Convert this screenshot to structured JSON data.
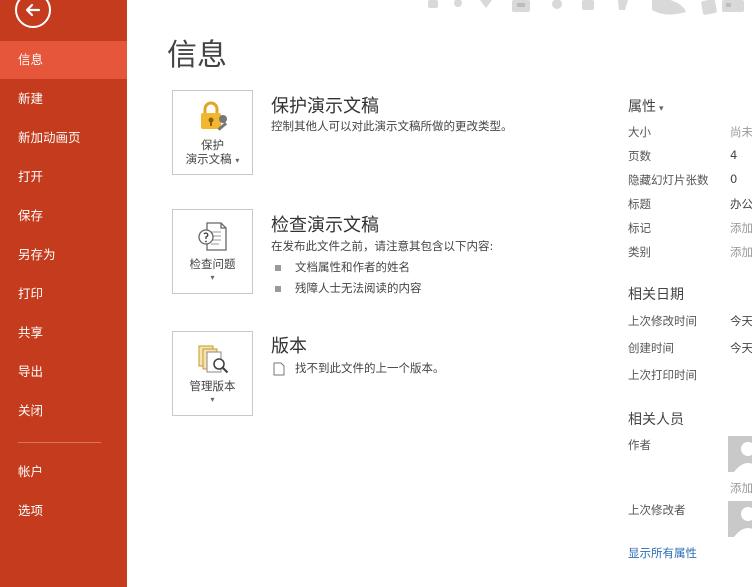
{
  "sidebar": {
    "items": [
      {
        "label": "信息"
      },
      {
        "label": "新建"
      },
      {
        "label": "新加动画页"
      },
      {
        "label": "打开"
      },
      {
        "label": "保存"
      },
      {
        "label": "另存为"
      },
      {
        "label": "打印"
      },
      {
        "label": "共享"
      },
      {
        "label": "导出"
      },
      {
        "label": "关闭"
      },
      {
        "label": "帐户"
      },
      {
        "label": "选项"
      }
    ],
    "active_index": 0,
    "accent_color": "#c43b1d",
    "active_color": "#e5563a"
  },
  "page": {
    "title": "信息"
  },
  "sections": {
    "protect": {
      "tile_line1": "保护",
      "tile_line2": "演示文稿",
      "title": "保护演示文稿",
      "desc": "控制其他人可以对此演示文稿所做的更改类型。"
    },
    "inspect": {
      "tile_label": "检查问题",
      "title": "检查演示文稿",
      "desc": "在发布此文件之前，请注意其包含以下内容:",
      "bullets": [
        "文档属性和作者的姓名",
        "残障人士无法阅读的内容"
      ]
    },
    "versions": {
      "tile_label": "管理版本",
      "title": "版本",
      "desc": "找不到此文件的上一个版本。"
    }
  },
  "properties": {
    "header": "属性",
    "rows": [
      {
        "label": "大小",
        "value": "尚未",
        "muted": true
      },
      {
        "label": "页数",
        "value": "4",
        "muted": false
      },
      {
        "label": "隐藏幻灯片张数",
        "value": "0",
        "muted": false
      },
      {
        "label": "标题",
        "value": "办公",
        "muted": false
      },
      {
        "label": "标记",
        "value": "添加",
        "muted": true
      },
      {
        "label": "类别",
        "value": "添加",
        "muted": true
      }
    ],
    "dates_header": "相关日期",
    "dates": [
      {
        "label": "上次修改时间",
        "value": "今天"
      },
      {
        "label": "创建时间",
        "value": "今天"
      },
      {
        "label": "上次打印时间",
        "value": ""
      }
    ],
    "people_header": "相关人员",
    "author_label": "作者",
    "author_add": "添加",
    "last_modified_by_label": "上次修改者",
    "show_all": "显示所有属性"
  }
}
